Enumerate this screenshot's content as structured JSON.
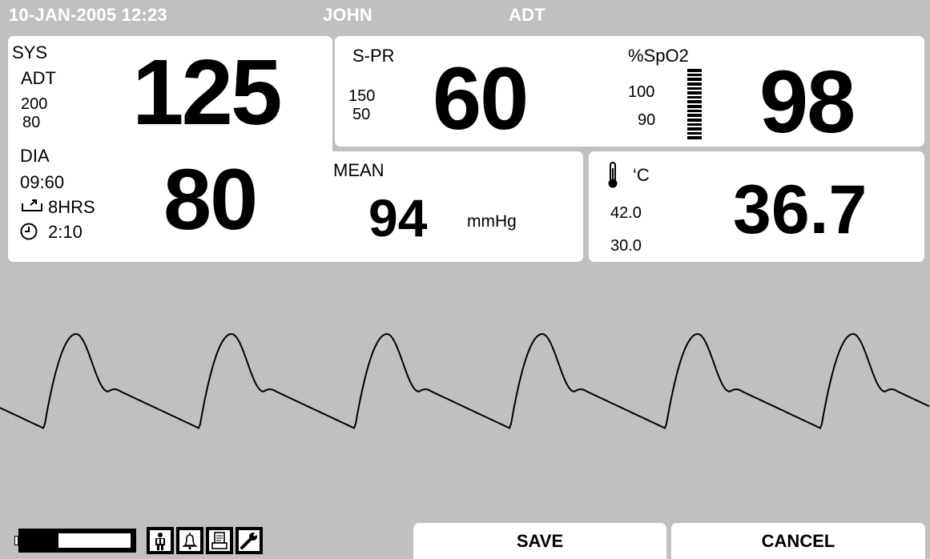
{
  "header": {
    "datetime": "10-JAN-2005 12:23",
    "patient_name": "JOHN",
    "mode": "ADT"
  },
  "nibp": {
    "sys_label": "SYS",
    "mode_label": "ADT",
    "sys_limit_high": "200",
    "sys_limit_low": "80",
    "sys_value": "125",
    "dia_label": "DIA",
    "interval": "09:60",
    "duration": "8HRS",
    "elapsed": "2:10",
    "dia_value": "80"
  },
  "pulse_rate": {
    "label": "S-PR",
    "limit_high": "150",
    "limit_low": "50",
    "value": "60"
  },
  "spo2": {
    "label": "%SpO2",
    "limit_high": "100",
    "limit_low": "90",
    "value": "98",
    "bar_level": 1.0
  },
  "mean": {
    "label": "MEAN",
    "value": "94",
    "unit": "mmHg"
  },
  "temperature": {
    "unit": "‘C",
    "limit_high": "42.0",
    "limit_low": "30.0",
    "value": "36.7"
  },
  "status_icons": [
    "battery-icon",
    "patient-icon",
    "alarm-bell-icon",
    "printer-icon",
    "wrench-icon"
  ],
  "buttons": {
    "save": "SAVE",
    "cancel": "CANCEL"
  },
  "colors": {
    "background": "#c0c0c0",
    "panel": "#ffffff",
    "text": "#000000",
    "header_text": "#ffffff"
  }
}
